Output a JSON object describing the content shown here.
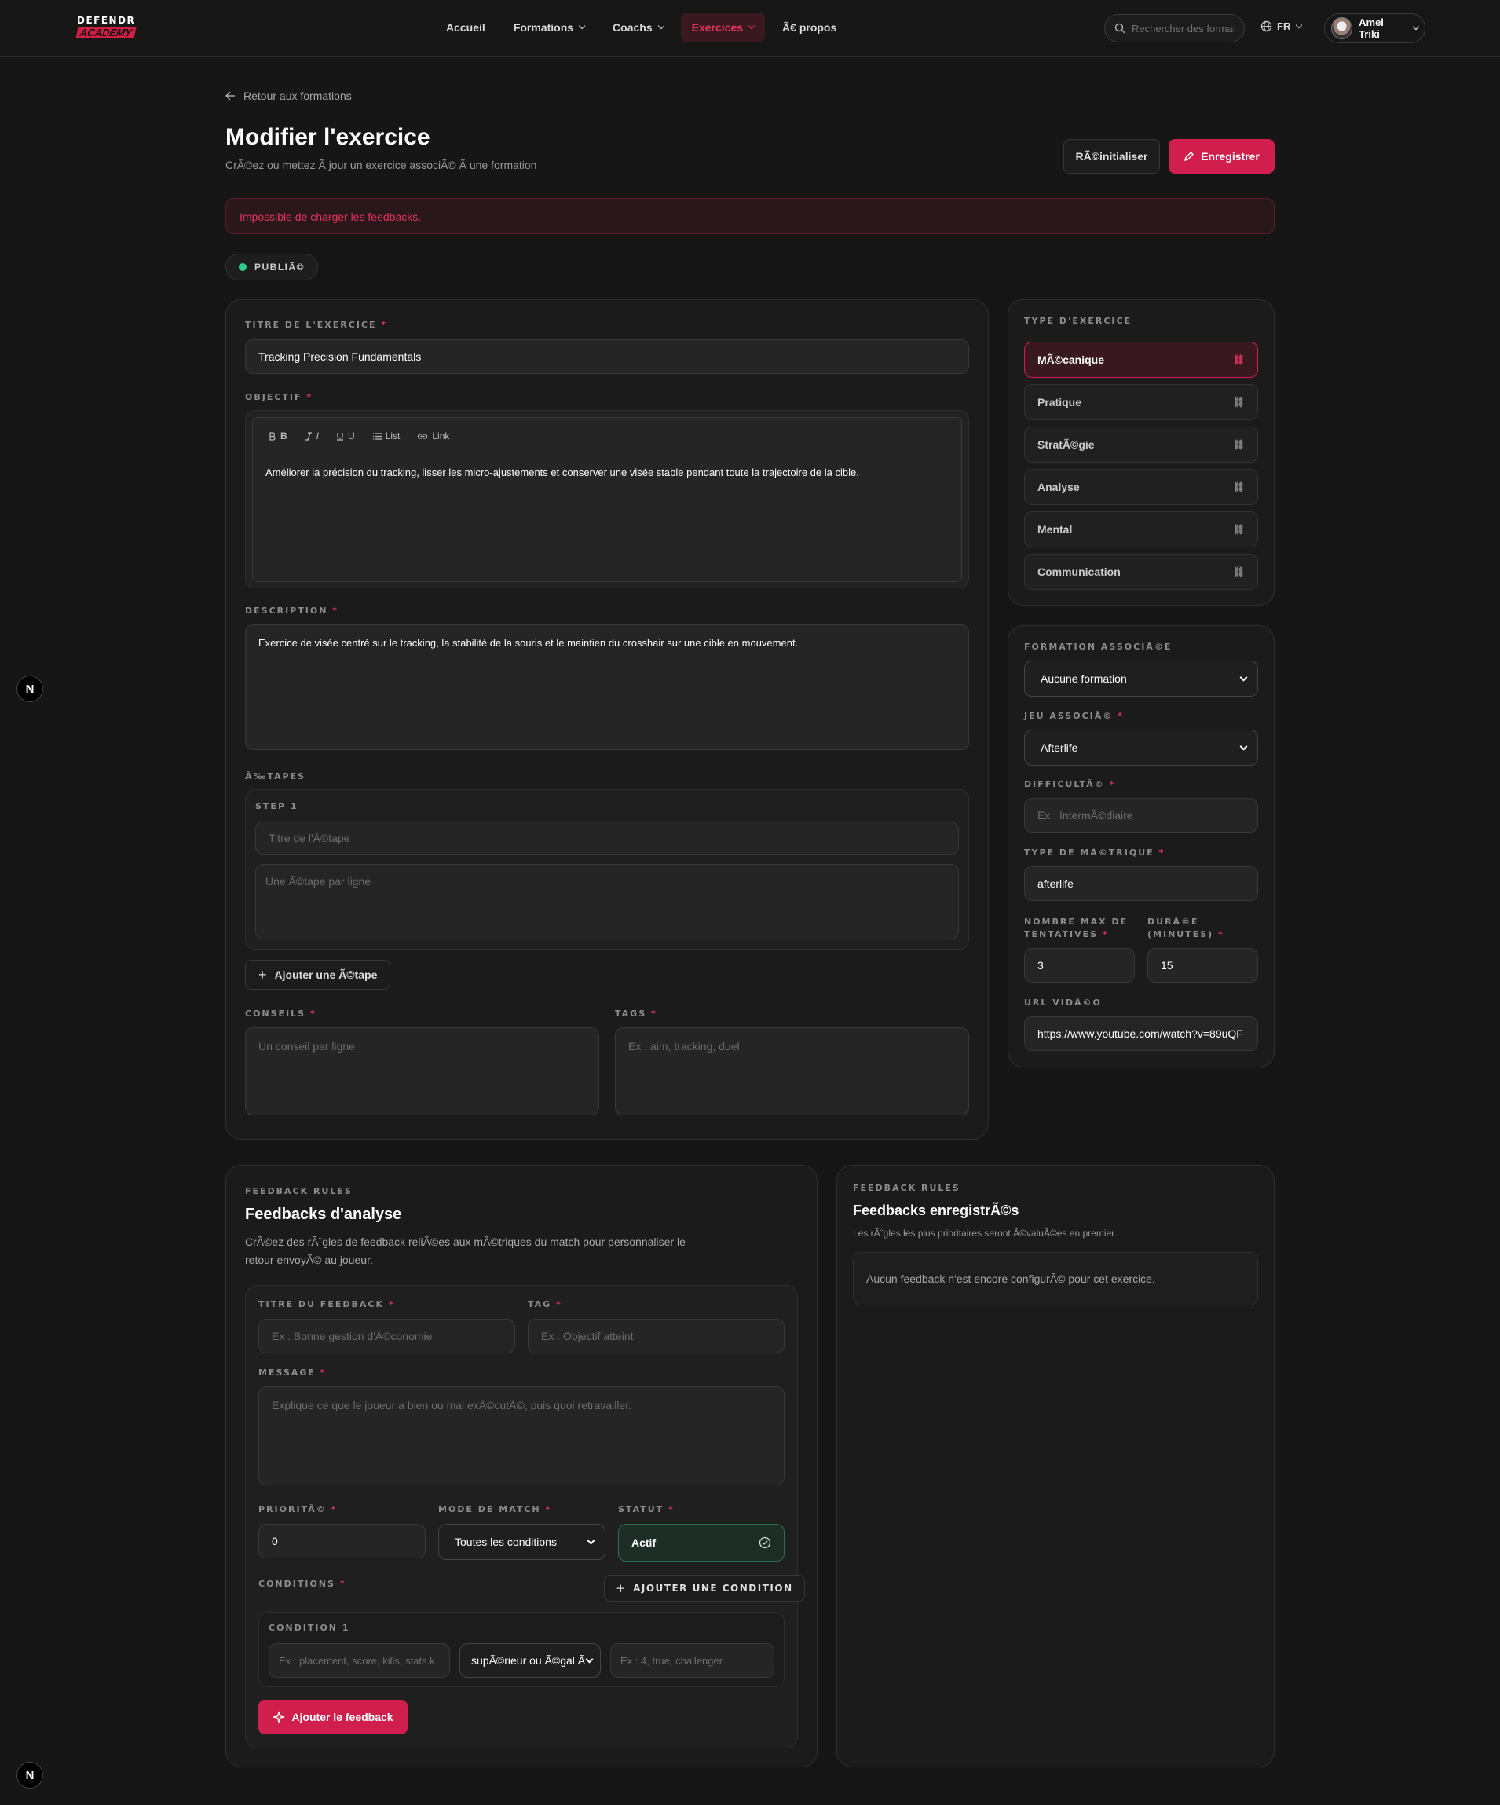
{
  "header": {
    "logo_top": "DEFENDR",
    "logo_bottom": "ACADEMY",
    "nav": [
      "Accueil",
      "Formations",
      "Coachs",
      "Exercices",
      "Ã€ propos"
    ],
    "search_placeholder": "Rechercher des formati",
    "lang": "FR",
    "user": "Amel Triki"
  },
  "page": {
    "back": "Retour aux formations",
    "title": "Modifier l'exercice",
    "subtitle": "CrÃ©ez ou mettez Ã  jour un exercice associÃ© Ã  une formation",
    "reset": "RÃ©initialiser",
    "save": "Enregistrer",
    "error": "Impossible de charger les feedbacks.",
    "status": "PUBLIÃ©"
  },
  "form": {
    "title_label": "TITRE DE L'EXERCICE",
    "title_value": "Tracking Precision Fundamentals",
    "objective_label": "OBJECTIF",
    "toolbar": {
      "bold": "B",
      "italic": "I",
      "underline": "U",
      "list": "List",
      "link": "Link"
    },
    "objective_text": "Améliorer la précision du tracking, lisser les micro-ajustements et conserver une visée stable pendant toute la trajectoire de la cible.",
    "description_label": "DESCRIPTION",
    "description_text": "Exercice de visée centré sur le tracking, la stabilité de la souris et le maintien du crosshair sur une cible en mouvement.",
    "steps_label": "Ã‰TAPES",
    "step1": "STEP 1",
    "step_title_ph": "Titre de l'Ã©tape",
    "step_lines_ph": "Une Ã©tape par ligne",
    "add_step": "Ajouter une Ã©tape",
    "tips_label": "CONSEILS",
    "tips_ph": "Un conseil par ligne",
    "tags_label": "TAGS",
    "tags_ph": "Ex : aim, tracking, duel"
  },
  "types": {
    "label": "TYPE D'EXERCICE",
    "items": [
      "MÃ©canique",
      "Pratique",
      "StratÃ©gie",
      "Analyse",
      "Mental",
      "Communication"
    ]
  },
  "side": {
    "formation_label": "FORMATION ASSOCIÃ©E",
    "formation_value": "Aucune formation",
    "game_label": "JEU ASSOCIÃ©",
    "game_value": "Afterlife",
    "difficulty_label": "DIFFICULTÃ©",
    "difficulty_ph": "Ex : IntermÃ©diaire",
    "metric_label": "TYPE DE MÃ©TRIQUE",
    "metric_value": "afterlife",
    "attempts_label1": "NOMBRE MAX DE",
    "attempts_label2": "TENTATIVES",
    "attempts_value": "3",
    "duration_label1": "DURÃ©E",
    "duration_label2": "(MINUTES)",
    "duration_value": "15",
    "video_label": "URL VIDÃ©O",
    "video_value": "https://www.youtube.com/watch?v=89uQF"
  },
  "feedback": {
    "kicker": "FEEDBACK RULES",
    "title": "Feedbacks d'analyse",
    "desc1": "CrÃ©ez des rÃ¨gles de feedback reliÃ©es aux mÃ©triques du match pour personnaliser le",
    "desc2": "retour envoyÃ© au joueur.",
    "ftitle_label": "TITRE DU FEEDBACK",
    "ftitle_ph": "Ex : Bonne gestion d'Ã©conomie",
    "tag_label": "TAG",
    "tag_ph": "Ex : Objectif atteint",
    "msg_label": "MESSAGE",
    "msg_ph": "Explique ce que le joueur a bien ou mal exÃ©cutÃ©, puis quoi retravailler.",
    "prio_label": "PRIORITÃ©",
    "prio_value": "0",
    "mode_label": "MODE DE MATCH",
    "mode_value": "Toutes les conditions",
    "statut_label": "STATUT",
    "statut_value": "Actif",
    "cond_label": "CONDITIONS",
    "add_cond": "AJOUTER UNE CONDITION",
    "cond1": "CONDITION 1",
    "cond_field_ph": "Ex : placement, score, kills, stats.k",
    "cond_op": "supÃ©rieur ou Ã©gal Ã",
    "cond_val_ph": "Ex : 4, true, challenger",
    "add_feedback": "Ajouter le feedback"
  },
  "saved": {
    "kicker": "FEEDBACK RULES",
    "title": "Feedbacks enregistrÃ©s",
    "desc": "Les rÃ¨gles les plus prioritaires seront Ã©valuÃ©es en premier.",
    "empty": "Aucun feedback n'est encore configurÃ© pour cet exercice."
  },
  "badge": "N",
  "colors": {
    "accent": "#d01f4c",
    "status_green": "#2ecf8a"
  }
}
